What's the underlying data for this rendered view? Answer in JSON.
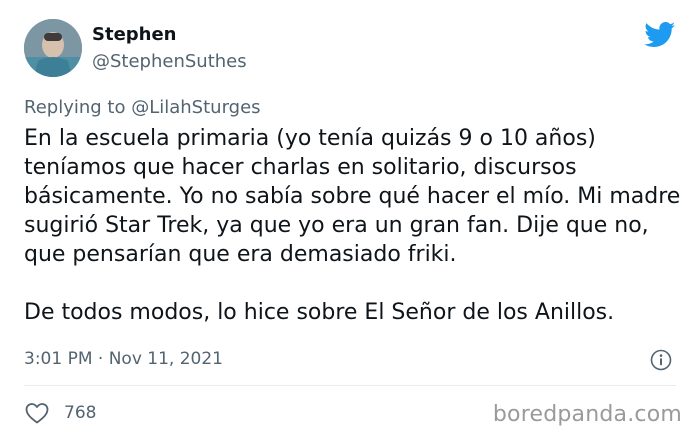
{
  "tweet": {
    "author_name": "Stephen",
    "author_handle": "@StephenSuthes",
    "replying_prefix": "Replying to ",
    "replying_to": "@LilahSturges",
    "paragraphs": [
      "En la escuela primaria (yo tenía quizás 9 o 10 años) teníamos que hacer charlas en solitario, discursos básicamente. Yo no sabía sobre qué hacer el mío. Mi madre sugirió Star Trek, ya que yo era un gran fan. Dije que no, que pensarían que era demasiado friki.",
      "De todos modos, lo hice sobre El Señor de los Anillos."
    ],
    "timestamp": "3:01 PM · Nov 11, 2021",
    "like_count": "768"
  },
  "icons": {
    "brand": "twitter-bird-icon",
    "info": "info-icon",
    "like": "heart-icon"
  },
  "colors": {
    "twitter_blue": "#1d9bf0",
    "text": "#0f1419",
    "muted": "#536471",
    "watermark": "#9a9a9a"
  },
  "watermark": "boredpanda.com"
}
